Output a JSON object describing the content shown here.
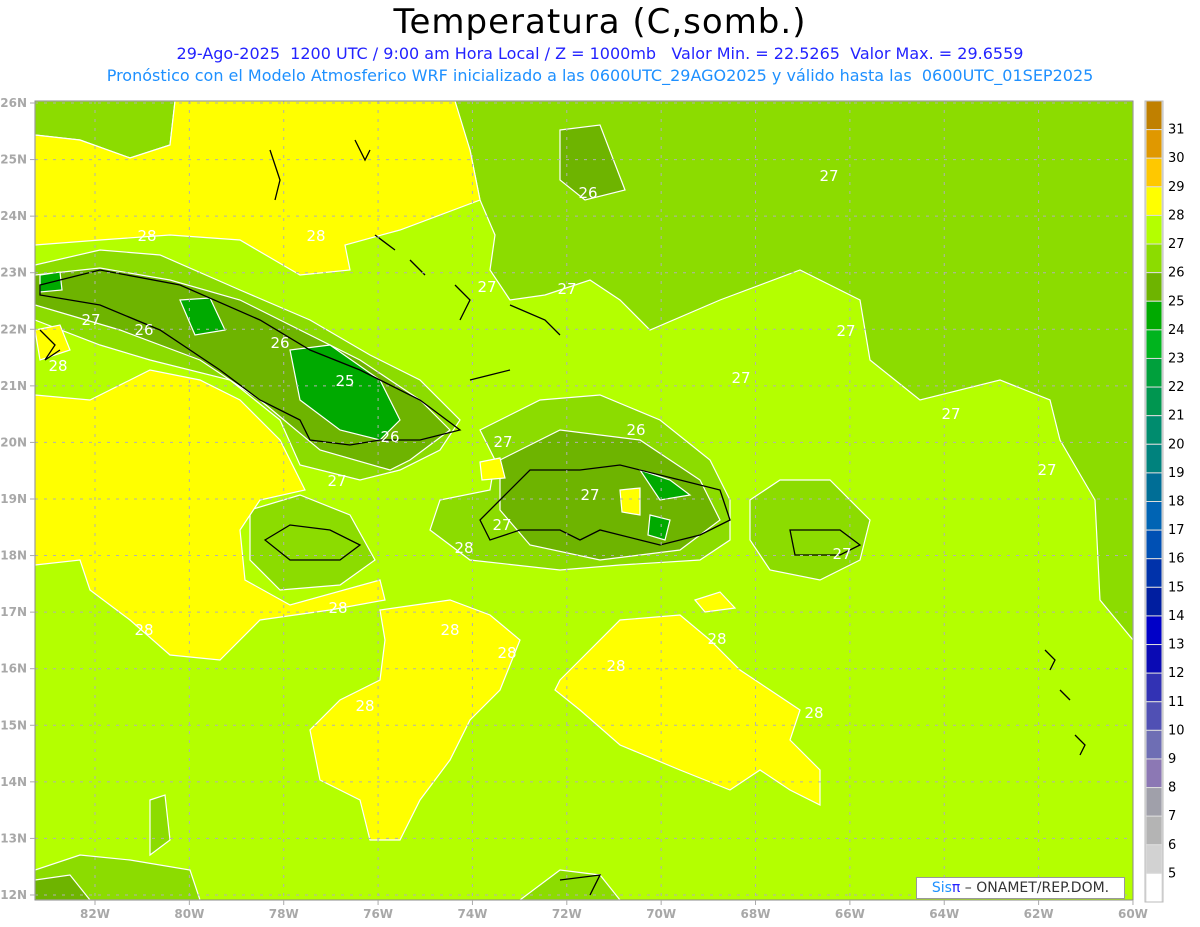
{
  "header": {
    "title": "Temperatura (C,somb.)",
    "line1": "29-Ago-2025  1200 UTC / 9:00 am Hora Local / Z = 1000mb   Valor Min. = 22.5265  Valor Max. = 29.6559",
    "line2": "Pronóstico con el Modelo Atmosferico WRF inicializado a las 0600UTC_29AGO2025 y válido hasta las  0600UTC_01SEP2025"
  },
  "map": {
    "lon_labels": [
      "82W",
      "80W",
      "78W",
      "76W",
      "74W",
      "72W",
      "70W",
      "68W",
      "66W",
      "64W",
      "62W",
      "60W"
    ],
    "lat_labels": [
      "26N",
      "25N",
      "24N",
      "23N",
      "22N",
      "21N",
      "20N",
      "19N",
      "18N",
      "17N",
      "16N",
      "15N",
      "14N",
      "13N",
      "12N"
    ],
    "contour_labels": [
      "28",
      "28",
      "27",
      "26",
      "28",
      "26",
      "25",
      "26",
      "27",
      "27",
      "27",
      "26",
      "27",
      "27",
      "27",
      "27",
      "27",
      "27",
      "26",
      "27",
      "27",
      "28",
      "27",
      "28",
      "28",
      "28",
      "28",
      "28",
      "28",
      "28",
      "28"
    ]
  },
  "colorbar": {
    "labels": [
      "31",
      "30",
      "29",
      "28",
      "27",
      "26",
      "25",
      "24",
      "23",
      "22",
      "21",
      "20",
      "19",
      "18",
      "17",
      "16",
      "15",
      "14",
      "13",
      "12",
      "11",
      "10",
      "9",
      "8",
      "7",
      "6",
      "5"
    ],
    "colors": [
      "#c08000",
      "#e09800",
      "#ffc800",
      "#ffff00",
      "#b4ff00",
      "#8cdc00",
      "#6eb400",
      "#00aa00",
      "#00b41e",
      "#00a03c",
      "#009650",
      "#008c6e",
      "#00827d",
      "#006e96",
      "#0064b4",
      "#0050b4",
      "#0032aa",
      "#001ea0",
      "#0000c8",
      "#0a0ab4",
      "#3232b4",
      "#5050b4",
      "#6e6eb4",
      "#8c78b4",
      "#a0a0aa",
      "#b4b4b4",
      "#d2d2d2",
      "#ffffff"
    ]
  },
  "logo": {
    "sis": "Sis",
    "pi": "π",
    "rest": " –  ONAMET/REP.DOM."
  }
}
